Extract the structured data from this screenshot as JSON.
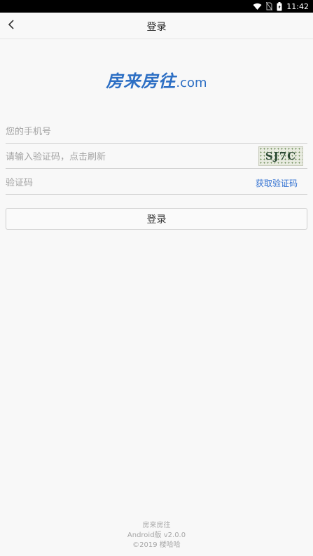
{
  "status_bar": {
    "time": "11:42"
  },
  "header": {
    "title": "登录"
  },
  "logo": {
    "brand": "房来房往",
    "domain": ".com"
  },
  "form": {
    "phone_placeholder": "您的手机号",
    "captcha_placeholder": "请输入验证码，点击刷新",
    "captcha_text": "SJ7C",
    "sms_code_placeholder": "验证码",
    "get_code_label": "获取验证码",
    "login_label": "登录"
  },
  "footer": {
    "app_name": "房来房往",
    "version": "Android版  v2.0.0",
    "copyright": "©2019 楼哈哈"
  },
  "colors": {
    "accent": "#2f6fd1",
    "brand": "#2d6fc4"
  }
}
